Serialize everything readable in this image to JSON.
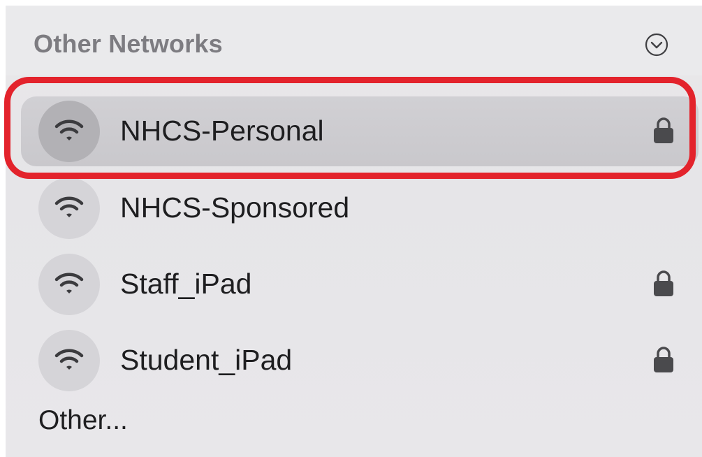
{
  "section": {
    "title": "Other Networks",
    "expand_icon": "chevron-down-circle-icon"
  },
  "networks": [
    {
      "name": "NHCS-Personal",
      "icon": "wifi-icon",
      "locked": true,
      "selected": true
    },
    {
      "name": "NHCS-Sponsored",
      "icon": "wifi-icon",
      "locked": false,
      "selected": false
    },
    {
      "name": "Staff_iPad",
      "icon": "wifi-icon",
      "locked": true,
      "selected": false
    },
    {
      "name": "Student_iPad",
      "icon": "wifi-icon",
      "locked": true,
      "selected": false
    }
  ],
  "other_label": "Other...",
  "colors": {
    "highlight": "#e3232c",
    "panel_bg": "#e8e7ea",
    "selected_row": "#cdccd0",
    "header_text": "#7d7c81",
    "text": "#1e1e20",
    "icon": "#4a4a4d"
  }
}
